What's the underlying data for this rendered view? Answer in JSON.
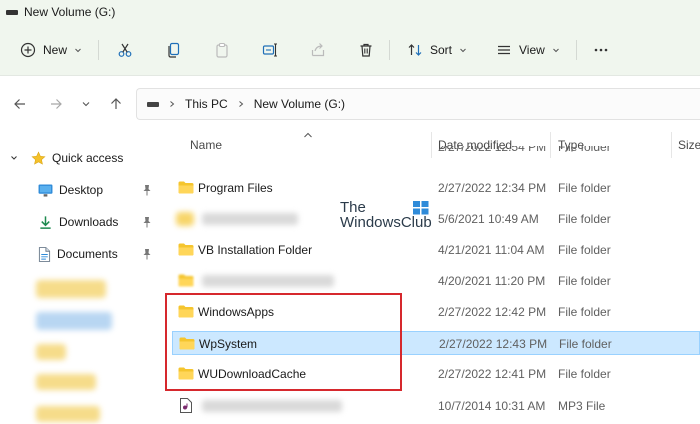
{
  "window": {
    "title": "New Volume (G:)"
  },
  "toolbar": {
    "new_label": "New",
    "sort_label": "Sort",
    "view_label": "View"
  },
  "address": {
    "crumbs": [
      "This PC",
      "New Volume (G:)"
    ]
  },
  "navpane": {
    "quick_access": "Quick access",
    "items": [
      "Desktop",
      "Downloads",
      "Documents"
    ]
  },
  "columns": {
    "name": "Name",
    "date": "Date modified",
    "type": "Type",
    "size": "Size"
  },
  "files": [
    {
      "name": "",
      "date": "2/27/2022 12:54 PM",
      "type": "File folder"
    },
    {
      "name": "Program Files",
      "date": "2/27/2022 12:34 PM",
      "type": "File folder"
    },
    {
      "name": "",
      "date": "5/6/2021 10:49 AM",
      "type": "File folder"
    },
    {
      "name": "VB Installation Folder",
      "date": "4/21/2021 11:04 AM",
      "type": "File folder"
    },
    {
      "name": "",
      "date": "4/20/2021 11:20 PM",
      "type": "File folder"
    },
    {
      "name": "WindowsApps",
      "date": "2/27/2022 12:42 PM",
      "type": "File folder"
    },
    {
      "name": "WpSystem",
      "date": "2/27/2022 12:43 PM",
      "type": "File folder"
    },
    {
      "name": "WUDownloadCache",
      "date": "2/27/2022 12:41 PM",
      "type": "File folder"
    },
    {
      "name": "",
      "date": "10/7/2014 10:31 AM",
      "type": "MP3 File"
    }
  ],
  "watermark": {
    "line1": "The",
    "line2": "WindowsClub"
  },
  "colors": {
    "folder": "#f5c52e",
    "selection": "#cce8ff",
    "highlight_box": "#d6282d",
    "accent": "#0067c0"
  }
}
